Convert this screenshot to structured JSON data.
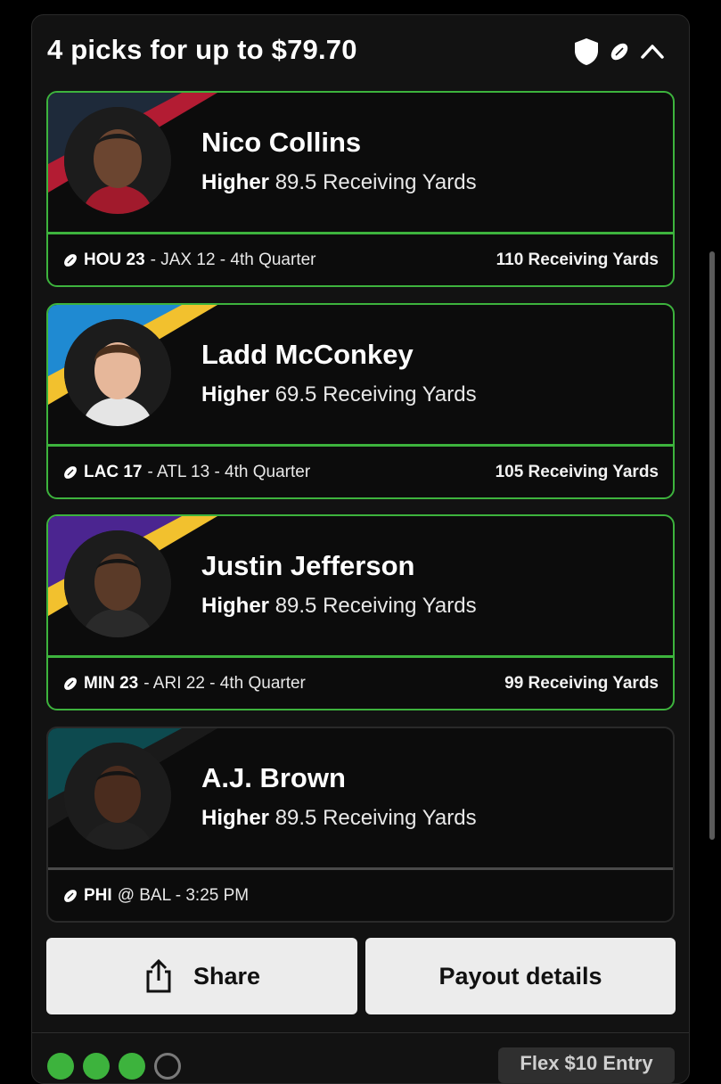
{
  "header": {
    "title": "4 picks for up to $79.70"
  },
  "picks": [
    {
      "name": "Nico Collins",
      "direction": "Higher",
      "line": "89.5 Receiving Yards",
      "team": "HOU 23",
      "game_rest": "- JAX 12 - 4th Quarter",
      "result": "110 Receiving Yards",
      "colors": {
        "a": "#1e2a3a",
        "b": "#b31c33"
      }
    },
    {
      "name": "Ladd McConkey",
      "direction": "Higher",
      "line": "69.5 Receiving Yards",
      "team": "LAC 17",
      "game_rest": "- ATL 13 - 4th Quarter",
      "result": "105 Receiving Yards",
      "colors": {
        "a": "#1f8ad2",
        "b": "#f2c12e"
      }
    },
    {
      "name": "Justin Jefferson",
      "direction": "Higher",
      "line": "89.5 Receiving Yards",
      "team": "MIN 23",
      "game_rest": "- ARI 22 - 4th Quarter",
      "result": "99 Receiving Yards",
      "colors": {
        "a": "#4b2590",
        "b": "#f2c12e"
      }
    },
    {
      "name": "A.J. Brown",
      "direction": "Higher",
      "line": "89.5 Receiving Yards",
      "team": "PHI",
      "game_rest": "@ BAL - 3:25 PM",
      "result": "",
      "colors": {
        "a": "#0d4a4f",
        "b": "#1a1a1a"
      }
    }
  ],
  "buttons": {
    "share": "Share",
    "payout": "Payout details"
  },
  "footer": {
    "legs": [
      "win",
      "win",
      "win",
      "open"
    ],
    "entry": "Flex $10 Entry"
  },
  "icons": {
    "header": [
      "shield-icon",
      "football-icon",
      "chevron-up-icon"
    ],
    "share": "share-icon",
    "game": "football-icon"
  },
  "accent": "#3db33d"
}
